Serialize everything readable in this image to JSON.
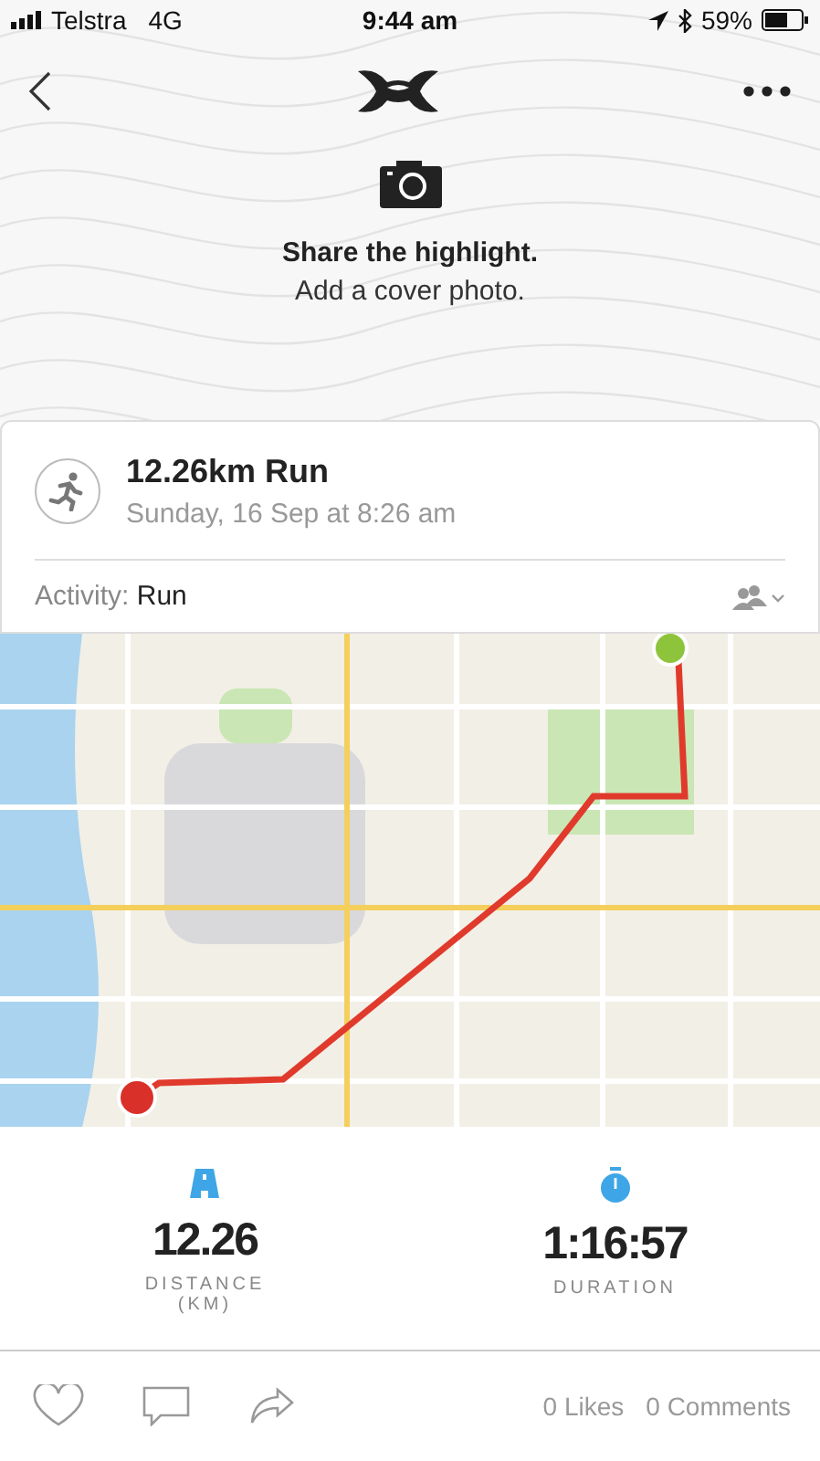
{
  "status_bar": {
    "carrier": "Telstra",
    "network": "4G",
    "time": "9:44 am",
    "battery": "59%"
  },
  "cover": {
    "title": "Share the highlight.",
    "subtitle": "Add a cover photo."
  },
  "workout": {
    "title": "12.26km Run",
    "date": "Sunday, 16 Sep at 8:26 am",
    "activity_label": "Activity:",
    "activity": "Run"
  },
  "stats": [
    {
      "kind": "distance",
      "value": "12.26",
      "label": "DISTANCE",
      "unit": "(KM)"
    },
    {
      "kind": "duration",
      "value": "1:16:57",
      "label": "DURATION"
    }
  ],
  "social": {
    "likes": "0 Likes",
    "comments": "0 Comments"
  }
}
